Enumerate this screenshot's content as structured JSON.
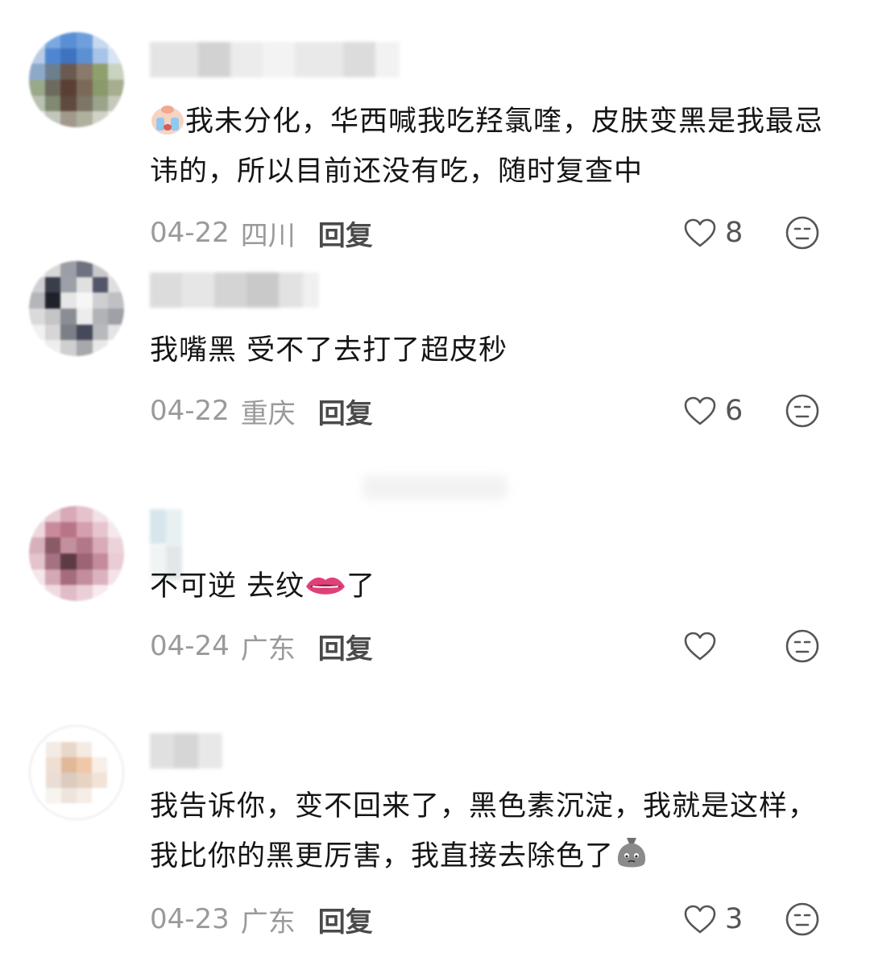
{
  "comments": [
    {
      "text": "我未分化，华西喊我吃羟氯喹，皮肤变黑是我最忌讳的，所以目前还没有吃，随时复查中",
      "leading_emoji": "crying-baby-emoji",
      "date": "04-22",
      "region": "四川",
      "reply_label": "回复",
      "likes": "8"
    },
    {
      "text": "我嘴黑 受不了去打了超皮秒",
      "date": "04-22",
      "region": "重庆",
      "reply_label": "回复",
      "likes": "6"
    },
    {
      "text_before": "不可逆 去纹",
      "inline_emoji": "lips-emoji",
      "text_after": "了",
      "date": "04-24",
      "region": "广东",
      "reply_label": "回复",
      "likes": ""
    },
    {
      "text": "我告诉你，变不回来了，黑色素沉淀，我就是这样，我比你的黑更厉害，我直接去除色了",
      "trailing_emoji": "sad-money-bag-emoji",
      "date": "04-23",
      "region": "广东",
      "reply_label": "回复",
      "likes": "3"
    }
  ],
  "icons": {
    "like": "heart-outline-icon",
    "dislike": "neutral-face-icon"
  },
  "colors": {
    "text": "#151515",
    "meta": "#9a9a9a",
    "reply": "#4a4a4a",
    "icon": "#555555"
  }
}
